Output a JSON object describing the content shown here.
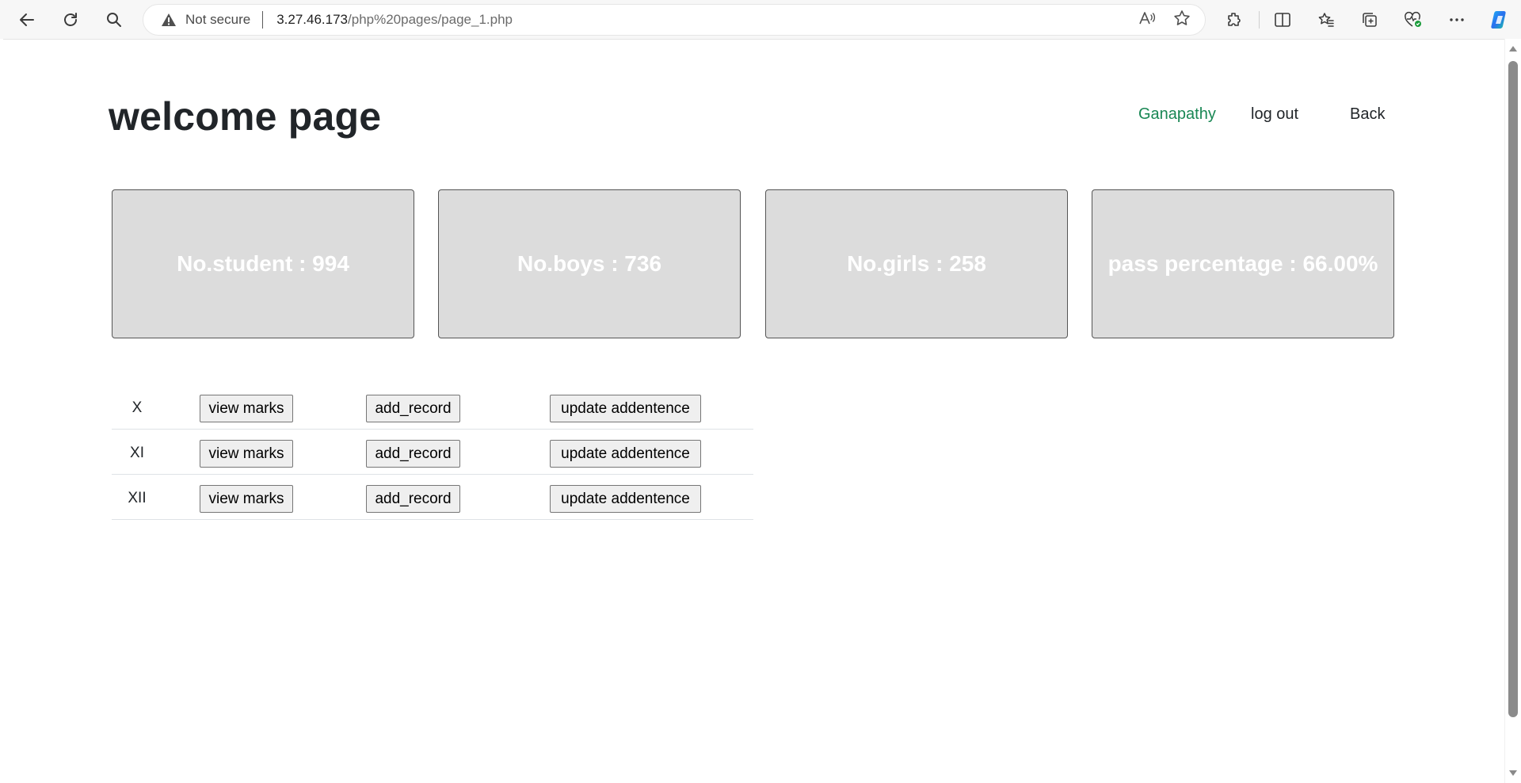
{
  "browser": {
    "security_label": "Not secure",
    "url_host": "3.27.46.173",
    "url_path": "/php%20pages/page_1.php",
    "read_aloud_glyph": "A⁾",
    "accent": "#0b6cd8"
  },
  "header": {
    "title": "welcome page",
    "user_link": "Ganapathy",
    "logout_link": "log out",
    "back_link": "Back",
    "user_color": "#198754"
  },
  "stats": [
    {
      "label": "No.student : 994"
    },
    {
      "label": "No.boys : 736"
    },
    {
      "label": "No.girls : 258"
    },
    {
      "label": "pass percentage : 66.00%"
    }
  ],
  "classes": [
    {
      "name": "X",
      "view_label": "view marks",
      "add_label": "add_record",
      "update_label": "update addentence"
    },
    {
      "name": "XI",
      "view_label": "view marks",
      "add_label": "add_record",
      "update_label": "update addentence"
    },
    {
      "name": "XII",
      "view_label": "view marks",
      "add_label": "add_record",
      "update_label": "update addentence"
    }
  ]
}
